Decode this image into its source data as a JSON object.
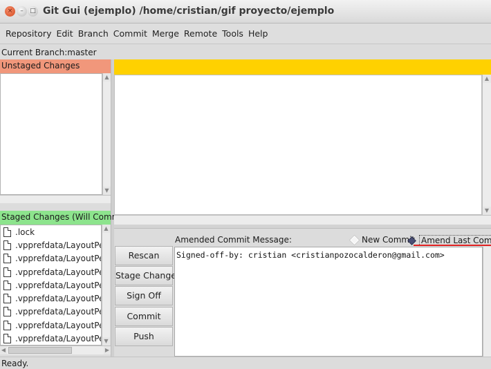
{
  "window": {
    "title": "Git Gui (ejemplo) /home/cristian/gif proyecto/ejemplo",
    "close_glyph": "×",
    "minimize_glyph": "–",
    "maximize_glyph": "□"
  },
  "menu": [
    "Repository",
    "Edit",
    "Branch",
    "Commit",
    "Merge",
    "Remote",
    "Tools",
    "Help"
  ],
  "branch": {
    "label": "Current Branch:",
    "name": "master"
  },
  "unstaged": {
    "header": "Unstaged Changes"
  },
  "staged": {
    "header": "Staged Changes (Will Commit)",
    "files": [
      ".lock",
      ".vpprefdata/LayoutPersp",
      ".vpprefdata/LayoutPersp",
      ".vpprefdata/LayoutPersp",
      ".vpprefdata/LayoutPersp",
      ".vpprefdata/LayoutPersp",
      ".vpprefdata/LayoutPersp",
      ".vpprefdata/LayoutPersp",
      ".vpprefdata/LayoutPersp"
    ]
  },
  "actions": [
    "Rescan",
    "Stage Changed",
    "Sign Off",
    "Commit",
    "Push"
  ],
  "commit": {
    "message_label": "Amended Commit Message:",
    "new_commit_label": "New Commit",
    "amend_label": "Amend Last Commit",
    "selected_option": "Amend Last Commit",
    "message": "Signed-off-by: cristian <cristianpozocalderon@gmail.com>"
  },
  "status": "Ready.",
  "colors": {
    "unstaged_header": "#f1977b",
    "staged_header": "#8de48d",
    "diff_header": "#ffd100",
    "highlight_underline": "#e02020"
  },
  "icons": {
    "file": "file-icon",
    "close": "close-icon",
    "minimize": "minimize-icon",
    "maximize": "maximize-icon"
  }
}
